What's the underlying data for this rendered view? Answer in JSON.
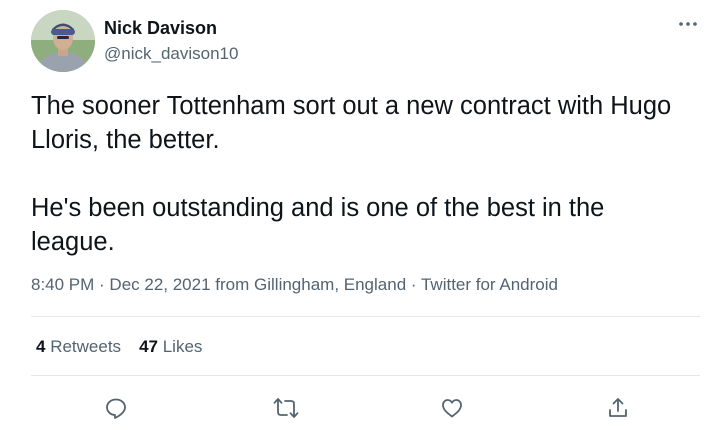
{
  "author": {
    "name": "Nick Davison",
    "handle": "@nick_davison10"
  },
  "menu_icon": "more-horizontal-icon",
  "text": {
    "paragraph_1": "The sooner Tottenham sort out a new contract with Hugo Lloris, the better.",
    "paragraph_2": "He's been outstanding and is one of the best in the league."
  },
  "meta": {
    "time": "8:40 PM",
    "separator_1": " · ",
    "date": "Dec 22, 2021",
    "location": " from Gillingham, England",
    "separator_2": " · ",
    "client": "Twitter for Android"
  },
  "stats": {
    "retweets_count": "4",
    "retweets_label": " Retweets",
    "likes_count": "47",
    "likes_label": " Likes"
  },
  "actions": [
    {
      "icon": "reply-icon"
    },
    {
      "icon": "retweet-icon"
    },
    {
      "icon": "like-icon"
    },
    {
      "icon": "share-icon"
    }
  ],
  "colors": {
    "primary_text": "#0f1419",
    "secondary_text": "#536471",
    "divider": "#e4e8eb"
  }
}
